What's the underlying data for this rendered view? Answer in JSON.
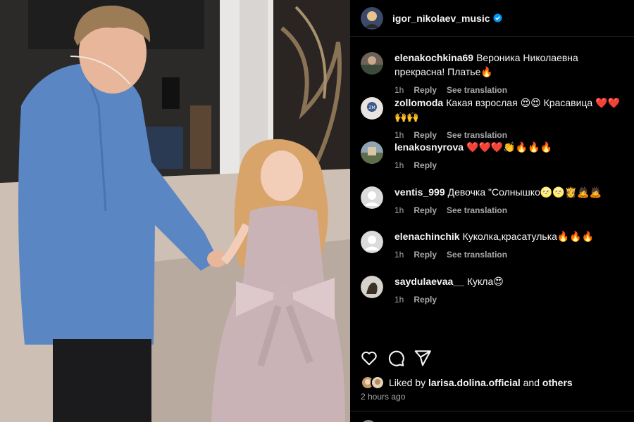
{
  "post": {
    "username": "igor_nikolaev_music",
    "verified": true,
    "avatar_icon": "profile-photo-icon"
  },
  "comments": [
    {
      "user": "elenakochkina69",
      "text": "Вероника Николаевна прекрасна! Платье🔥",
      "time": "1h",
      "reply": "Reply",
      "translate": "See translation",
      "avatar": "avatar-photo"
    },
    {
      "user": "zollomoda",
      "text": "Какая взрослая 😍😍 Красавица ❤️❤️🙌🙌",
      "time": "1h",
      "reply": "Reply",
      "translate": "See translation",
      "avatar": "avatar-photo"
    },
    {
      "user": "lenakosnyrova",
      "text": "❤️❤️❤️👏🔥🔥🔥",
      "time": "1h",
      "reply": "Reply",
      "translate": "",
      "avatar": "avatar-photo"
    },
    {
      "user": "ventis_999",
      "text": "Девочка \"Солнышко🌝🌝👸🙇🙇",
      "time": "1h",
      "reply": "Reply",
      "translate": "See translation",
      "avatar": "default-avatar"
    },
    {
      "user": "elenachinchik",
      "text": "Куколка,красатулька🔥🔥🔥",
      "time": "1h",
      "reply": "Reply",
      "translate": "See translation",
      "avatar": "default-avatar"
    },
    {
      "user": "saydulaevaa__",
      "text": "Кукла😍",
      "time": "1h",
      "reply": "Reply",
      "translate": "",
      "avatar": "avatar-photo"
    }
  ],
  "actions": {
    "like_icon": "heart-icon",
    "comment_icon": "comment-bubble-icon",
    "share_icon": "paper-plane-icon"
  },
  "likes": {
    "prefix": "Liked by",
    "user": "larisa.dolina.official",
    "conj": "and",
    "others": "others"
  },
  "time_ago": "2 hours ago",
  "colors": {
    "background": "#000000",
    "text": "#f5f5f5",
    "muted": "#a8a8a8",
    "verified": "#0095f6",
    "divider": "#262626"
  }
}
